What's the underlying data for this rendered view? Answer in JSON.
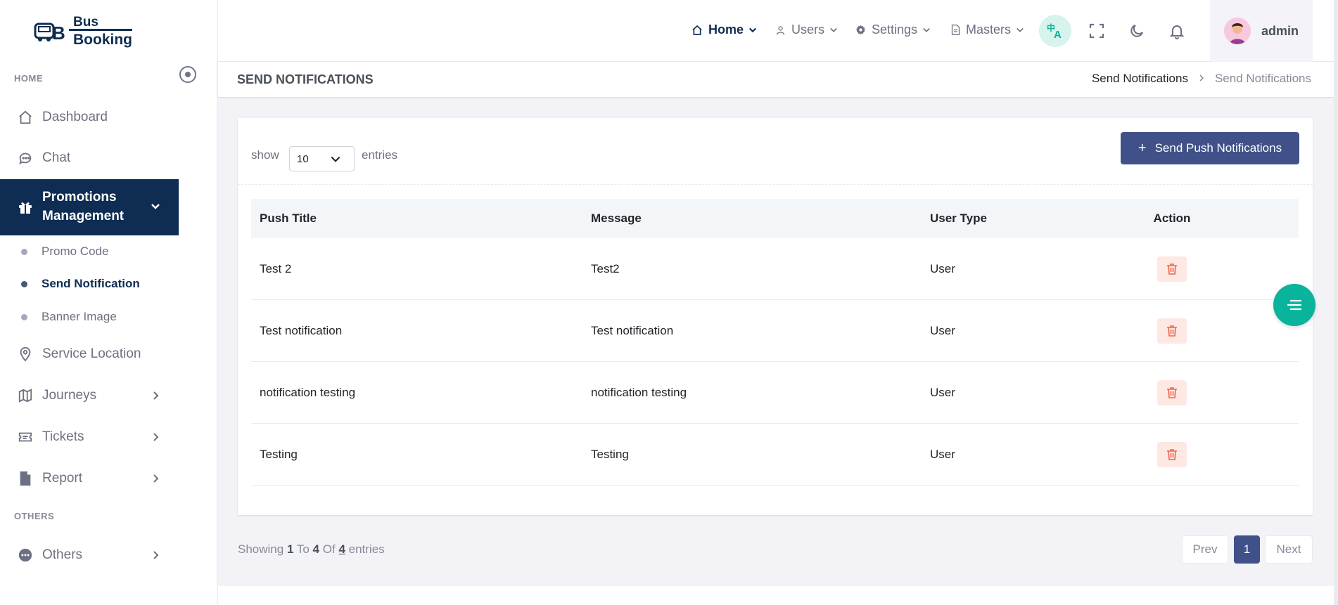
{
  "brand": {
    "line1": "Bus",
    "line2": "Booking"
  },
  "sidebar": {
    "home_title": "HOME",
    "others_title": "OTHERS",
    "dashboard": "Dashboard",
    "chat": "Chat",
    "promotions": "Promotions Management",
    "promo_code": "Promo Code",
    "send_notification": "Send Notification",
    "banner_image": "Banner Image",
    "service_location": "Service Location",
    "journeys": "Journeys",
    "tickets": "Tickets",
    "report": "Report",
    "others": "Others"
  },
  "topbar": {
    "home": "Home",
    "users": "Users",
    "settings": "Settings",
    "masters": "Masters",
    "username": "admin"
  },
  "page": {
    "title": "SEND NOTIFICATIONS",
    "breadcrumb_parent": "Send Notifications",
    "breadcrumb_current": "Send Notifications"
  },
  "card": {
    "show_label": "show",
    "entries_value": "10",
    "entries_label": "entries",
    "send_button": "Send Push Notifications"
  },
  "table": {
    "headers": [
      "Push Title",
      "Message",
      "User Type",
      "Action"
    ],
    "rows": [
      {
        "title": "Test 2",
        "message": "Test2",
        "user_type": "User"
      },
      {
        "title": "Test notification",
        "message": "Test notification",
        "user_type": "User"
      },
      {
        "title": "notification testing",
        "message": "notification testing",
        "user_type": "User"
      },
      {
        "title": "Testing",
        "message": "Testing",
        "user_type": "User"
      }
    ]
  },
  "pagination": {
    "showing_prefix": "Showing",
    "from": "1",
    "to_word": "To",
    "to": "4",
    "of_word": "Of",
    "total": "4",
    "suffix": "entries",
    "prev": "Prev",
    "page": "1",
    "next": "Next"
  },
  "colors": {
    "primary": "#405189",
    "sidebar_active": "#0f2d52",
    "fab": "#0ab39c",
    "delete_bg": "#fde8e4",
    "delete_icon": "#f06548"
  },
  "icons": {
    "dashboard": "home-icon",
    "chat": "chat-icon",
    "promotions": "gift-icon",
    "service_location": "map-pin-icon",
    "journeys": "map-icon",
    "tickets": "ticket-icon",
    "report": "file-icon",
    "others": "dots-icon",
    "delete": "trash-icon",
    "fab": "menu-lines-icon"
  }
}
